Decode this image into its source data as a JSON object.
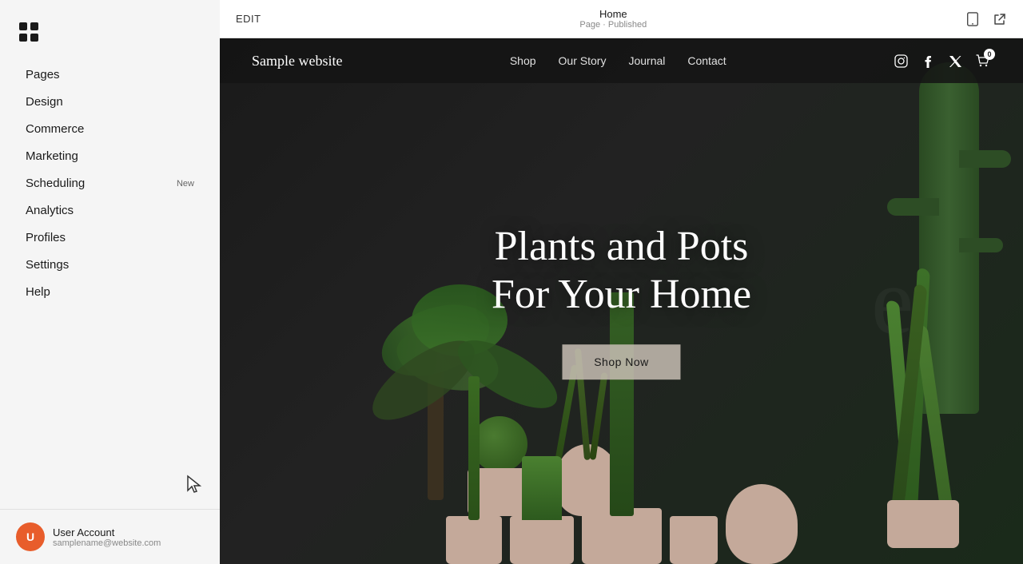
{
  "sidebar": {
    "logo_alt": "Squarespace logo",
    "nav_items": [
      {
        "id": "pages",
        "label": "Pages",
        "badge": null
      },
      {
        "id": "design",
        "label": "Design",
        "badge": null
      },
      {
        "id": "commerce",
        "label": "Commerce",
        "badge": null
      },
      {
        "id": "marketing",
        "label": "Marketing",
        "badge": null
      },
      {
        "id": "scheduling",
        "label": "Scheduling",
        "badge": "New"
      },
      {
        "id": "analytics",
        "label": "Analytics",
        "badge": null
      },
      {
        "id": "profiles",
        "label": "Profiles",
        "badge": null
      },
      {
        "id": "settings",
        "label": "Settings",
        "badge": null
      },
      {
        "id": "help",
        "label": "Help",
        "badge": null
      }
    ],
    "user": {
      "initials": "U",
      "name": "User Account",
      "email": "samplename@website.com"
    }
  },
  "topbar": {
    "edit_label": "EDIT",
    "page_title": "Home",
    "page_status": "Page · Published"
  },
  "website": {
    "site_title": "Sample website",
    "nav_links": [
      {
        "id": "shop",
        "label": "Shop"
      },
      {
        "id": "our-story",
        "label": "Our Story"
      },
      {
        "id": "journal",
        "label": "Journal"
      },
      {
        "id": "contact",
        "label": "Contact"
      }
    ],
    "hero_headline_line1": "Plants and Pots",
    "hero_headline_line2": "For Your Home",
    "hero_cta_label": "Shop Now",
    "decor_text": "es"
  }
}
